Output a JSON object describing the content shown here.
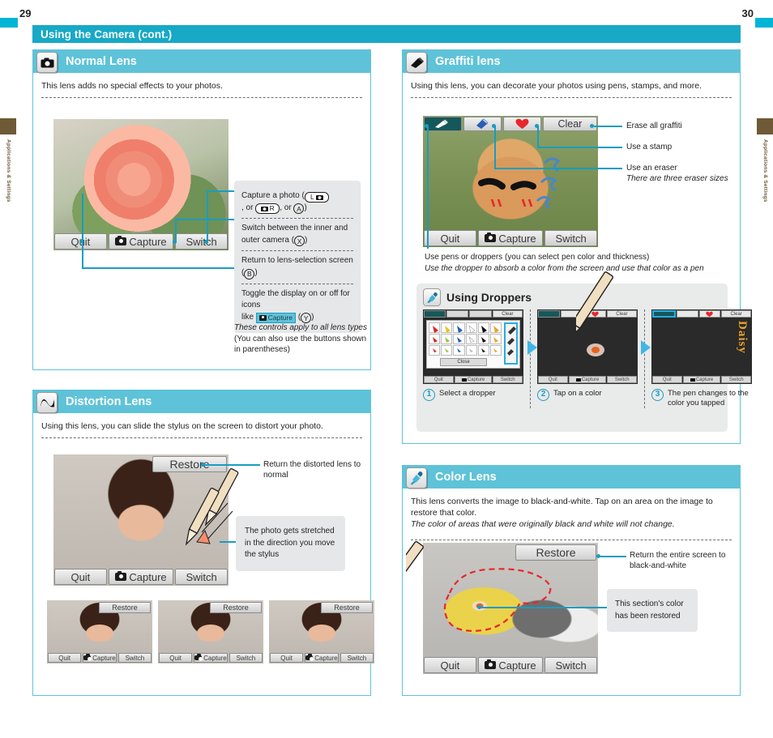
{
  "page": {
    "left_number": "29",
    "right_number": "30"
  },
  "side_tab": {
    "label": "Applications & Settings"
  },
  "header": {
    "title": "Using the Camera (cont.)"
  },
  "sections": {
    "normal_lens": {
      "title": "Normal Lens",
      "icon": "camera-icon",
      "lead": "This lens adds no special effects to your photos.",
      "screen_buttons": {
        "quit": "Quit",
        "capture": "Capture",
        "switch": "Switch"
      },
      "callouts": {
        "capture": "Capture a photo (",
        "capture_tail": ", or ",
        "capture_end": ")",
        "capture_pill_l": "L",
        "capture_pill_r": "R",
        "capture_btn_a": "A",
        "switch": "Switch between the inner and outer camera (",
        "switch_btn": "X",
        "switch_end": ")",
        "return": "Return to lens-selection screen (",
        "return_btn": "B",
        "return_end": ")",
        "toggle_1": "Toggle the display on or off for icons",
        "toggle_2_pre": "like ",
        "toggle_chip": "Capture",
        "toggle_btn": "Y",
        "toggle_end": ")",
        "toggle_2_mid": " ("
      },
      "footnote_1": "These controls apply to all lens types",
      "footnote_2": "(You can also use the buttons shown in parentheses)"
    },
    "distortion_lens": {
      "title": "Distortion Lens",
      "icon": "wave-icon",
      "lead": "Using this lens, you can slide the stylus on the screen to distort your photo.",
      "restore_label": "Restore",
      "callout_restore": "Return the distorted lens to normal",
      "callout_stretch": "The photo gets stretched in the direction you move the stylus",
      "screen_buttons": {
        "quit": "Quit",
        "capture": "Capture",
        "switch": "Switch"
      },
      "thumbnails": [
        {
          "restore": "Restore",
          "quit": "Quit",
          "capture": "Capture",
          "switch": "Switch"
        },
        {
          "restore": "Restore",
          "quit": "Quit",
          "capture": "Capture",
          "switch": "Switch"
        },
        {
          "restore": "Restore",
          "quit": "Quit",
          "capture": "Capture",
          "switch": "Switch"
        }
      ]
    },
    "graffiti_lens": {
      "title": "Graffiti lens",
      "icon": "eraser-icon",
      "lead": "Using this lens, you can decorate your photos using pens, stamps, and more.",
      "clear_label": "Clear",
      "screen_buttons": {
        "quit": "Quit",
        "capture": "Capture",
        "switch": "Switch"
      },
      "callouts": {
        "clear": "Erase all graffiti",
        "stamp": "Use a stamp",
        "eraser": "Use an eraser",
        "eraser_note": "There are three eraser sizes"
      },
      "note_1": "Use pens or droppers (you can select pen color and thickness)",
      "note_2": "Use the dropper to absorb a color from the screen and use that color as a pen",
      "droppers": {
        "title": "Using Droppers",
        "icon": "dropper-icon",
        "steps": [
          {
            "number": "1",
            "caption": "Select a dropper",
            "close_label": "Close",
            "clear_label": "Clear"
          },
          {
            "number": "2",
            "caption": "Tap on a color",
            "clear_label": "Clear"
          },
          {
            "number": "3",
            "caption": "The pen changes to the color you tapped",
            "clear_label": "Clear"
          }
        ],
        "mini_buttons": {
          "quit": "Quit",
          "capture": "Capture",
          "switch": "Switch"
        },
        "daisy_text": "Daisy"
      }
    },
    "color_lens": {
      "title": "Color Lens",
      "icon": "dropper-icon",
      "lead_1": "This lens converts the image to black-and-white. Tap on an area on the image to restore that color.",
      "lead_2": "The color of areas that were originally black and white will not change.",
      "restore_label": "Restore",
      "screen_buttons": {
        "quit": "Quit",
        "capture": "Capture",
        "switch": "Switch"
      },
      "callouts": {
        "restore": "Return the entire screen to black-and-white",
        "restored": "This section's color has been restored"
      }
    }
  },
  "colors": {
    "title_bar": "#17a9c6",
    "section_head": "#5ec3d8",
    "leader_line": "#1a9cc0",
    "side_tab": "#6f5a37",
    "grey_box": "#e6e7e8"
  }
}
